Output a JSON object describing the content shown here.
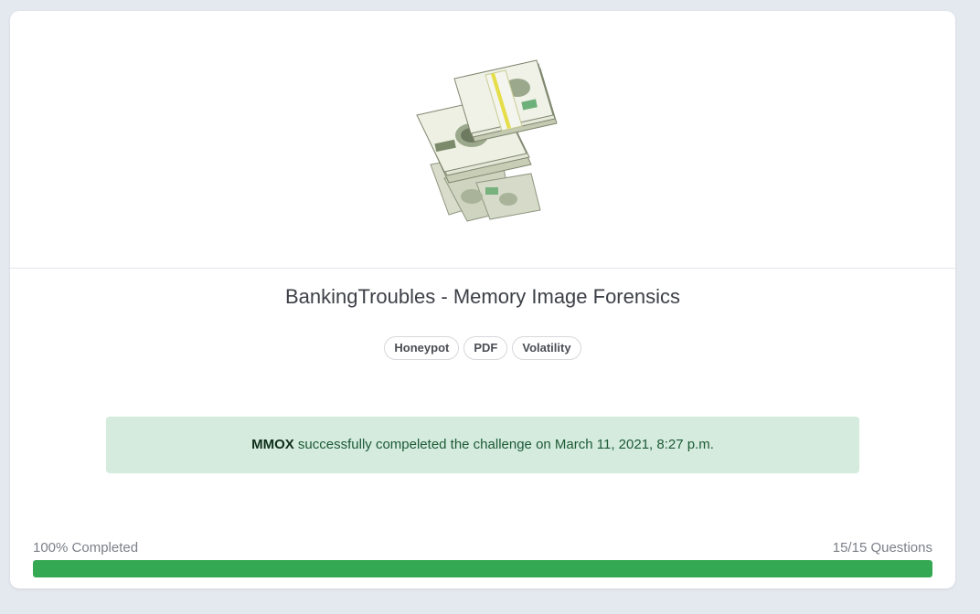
{
  "challenge": {
    "title": "BankingTroubles - Memory Image Forensics",
    "tags": [
      "Honeypot",
      "PDF",
      "Volatility"
    ],
    "image_icon": "money-stack-icon"
  },
  "completion": {
    "user": "MMOX",
    "message": "successfully compeleted the challenge on March 11, 2021, 8:27 p.m."
  },
  "progress": {
    "completed_label": "100% Completed",
    "questions_label": "15/15 Questions",
    "fraction": 1.0
  },
  "colors": {
    "progress": "#34a853",
    "alert_bg": "#d4ebdd",
    "alert_text": "#1e5a36"
  }
}
